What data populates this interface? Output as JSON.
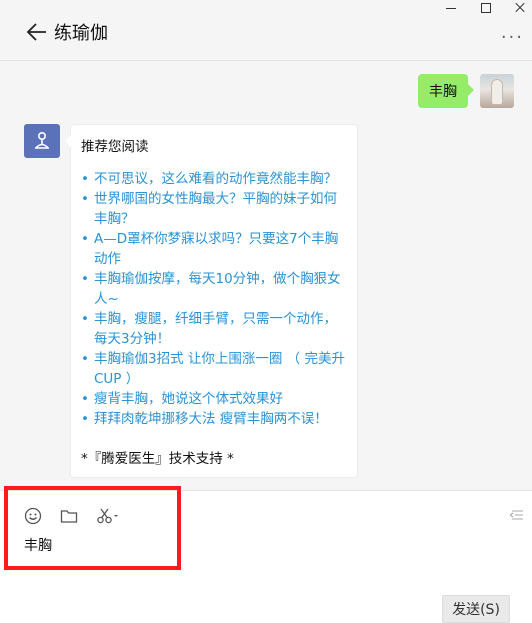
{
  "header": {
    "title": "练瑜伽",
    "more_label": "..."
  },
  "chat": {
    "outgoing": {
      "text": "丰胸"
    },
    "incoming": {
      "intro": "推荐您阅读",
      "articles": [
        "不可思议，这么难看的动作竟然能丰胸？",
        "世界哪国的女性胸最大？平胸的妹子如何丰胸？",
        "A—D罩杯你梦寐以求吗？只要这7个丰胸动作",
        "丰胸瑜伽按摩，每天10分钟，做个胸狠女人~",
        "丰胸，瘦腿，纤细手臂，只需一个动作，每天3分钟！",
        "丰胸瑜伽3招式 让你上围涨一圈 （ 完美升CUP ）",
        "瘦背丰胸，她说这个体式效果好",
        "拜拜肉乾坤挪移大法 瘦臂丰胸两不误！"
      ],
      "footer": "*『腾爱医生』技术支持 *"
    }
  },
  "input": {
    "draft": "丰胸",
    "send_label": "发送(S)"
  },
  "colors": {
    "accent_bubble": "#95ec69",
    "link": "#2a93d5",
    "highlight": "#ff1b1b",
    "bot_avatar": "#5b72b8"
  },
  "icons": [
    "back-arrow-icon",
    "emoji-icon",
    "folder-icon",
    "scissors-icon",
    "expand-icon",
    "more-icon"
  ]
}
